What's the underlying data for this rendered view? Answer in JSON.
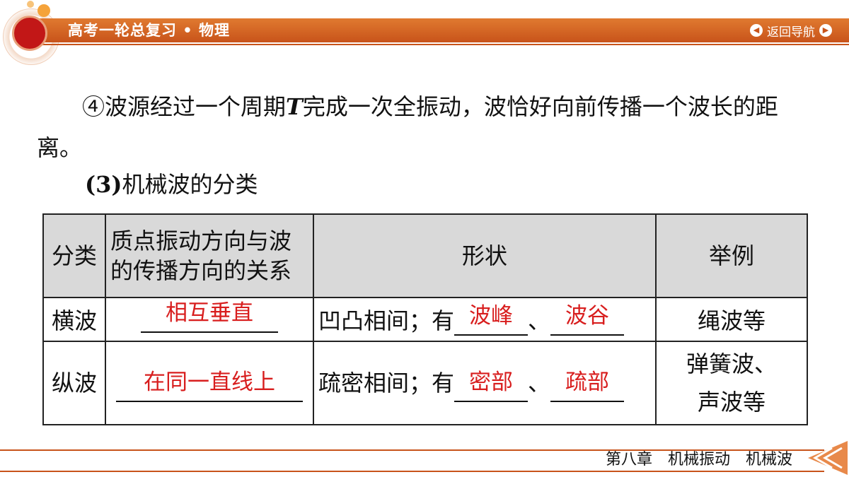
{
  "header": {
    "title": "高考一轮总复习 • 物理",
    "nav_label": "返回导航",
    "prev_icon": "chevron-left-icon",
    "next_icon": "chevron-right-icon"
  },
  "body": {
    "para_part1": "④波源经过一个周期",
    "para_T": "T",
    "para_part2": "完成一次全振动，波恰好向前传播一个波长的距离。",
    "sub_num": "(3)",
    "sub_text": "机械波的分类"
  },
  "table": {
    "headers": [
      "分类",
      "质点振动方向与波的传播方向的关系",
      "形状",
      "举例"
    ],
    "rows": [
      {
        "type": "横波",
        "relation_answer": "相互垂直",
        "shape_prefix": "凹凸相间；有",
        "shape_answer1": "波峰",
        "separator": "、",
        "shape_answer2": "波谷",
        "example": "绳波等"
      },
      {
        "type": "纵波",
        "relation_answer": "在同一直线上",
        "shape_prefix": "疏密相间；有",
        "shape_answer1": "密部",
        "separator": "、",
        "shape_answer2": "疏部",
        "example_line1": "弹簧波、",
        "example_line2": "声波等"
      }
    ]
  },
  "footer": {
    "chapter_text": "第八章　机械振动　机械波"
  },
  "colors": {
    "accent": "#c8531a",
    "answer": "#d81e1e",
    "header_fill": "#d9d9d9"
  }
}
